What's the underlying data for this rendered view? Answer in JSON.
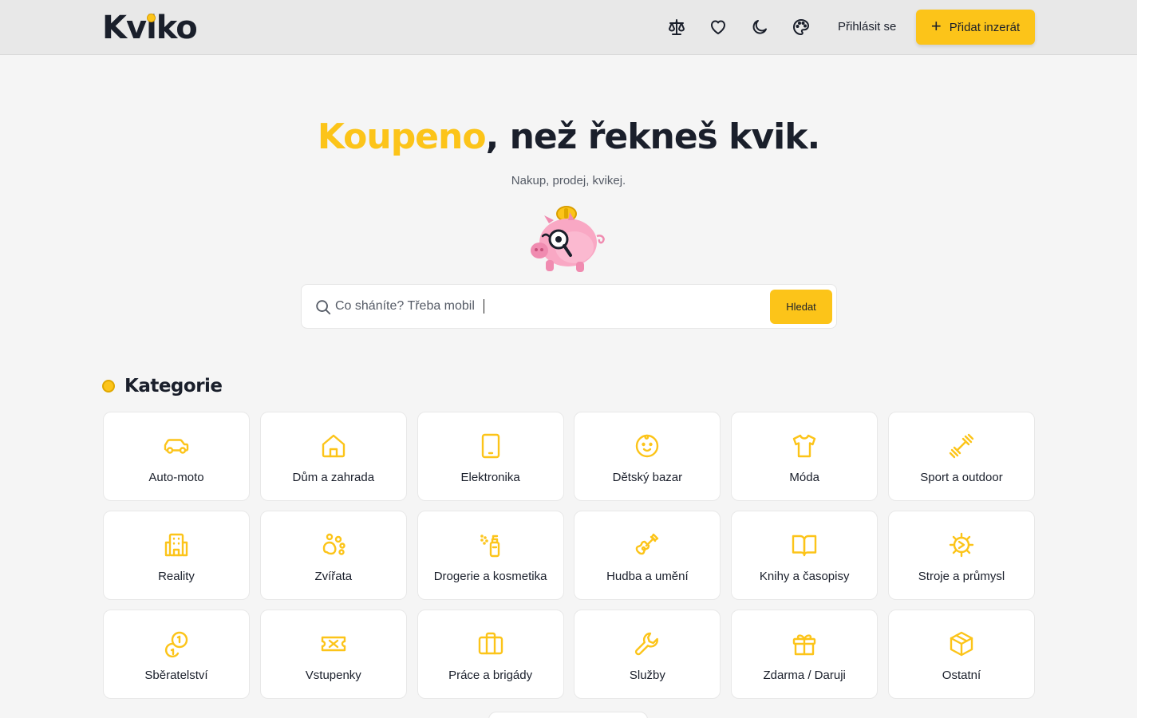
{
  "header": {
    "logo": "Kviko",
    "icons": [
      "scale-icon",
      "heart-icon",
      "moon-icon",
      "palette-icon"
    ],
    "login_label": "Přihlásit se",
    "add_label": "Přidat inzerát"
  },
  "hero": {
    "title_accent": "Koupeno",
    "title_rest": ", než řekneš kvik.",
    "subtitle": "Nakup, prodej, kvikej."
  },
  "search": {
    "placeholder": "Co sháníte? Třeba mobil",
    "button_label": "Hledat"
  },
  "categories": {
    "title": "Kategorie",
    "items": [
      {
        "label": "Auto-moto",
        "icon": "car-icon"
      },
      {
        "label": "Dům a zahrada",
        "icon": "house-icon"
      },
      {
        "label": "Elektronika",
        "icon": "tablet-icon"
      },
      {
        "label": "Dětský bazar",
        "icon": "baby-icon"
      },
      {
        "label": "Móda",
        "icon": "shirt-icon"
      },
      {
        "label": "Sport a outdoor",
        "icon": "dumbbell-icon"
      },
      {
        "label": "Reality",
        "icon": "building-icon"
      },
      {
        "label": "Zvířata",
        "icon": "paw-icon"
      },
      {
        "label": "Drogerie a kosmetika",
        "icon": "spray-bottle-icon"
      },
      {
        "label": "Hudba a umění",
        "icon": "guitar-icon"
      },
      {
        "label": "Knihy a časopisy",
        "icon": "book-icon"
      },
      {
        "label": "Stroje a průmysl",
        "icon": "gear-icon"
      },
      {
        "label": "Sběratelství",
        "icon": "coins-icon"
      },
      {
        "label": "Vstupenky",
        "icon": "ticket-icon"
      },
      {
        "label": "Práce a brigády",
        "icon": "briefcase-icon"
      },
      {
        "label": "Služby",
        "icon": "wrench-icon"
      },
      {
        "label": "Zdarma / Daruji",
        "icon": "gift-icon"
      },
      {
        "label": "Ostatní",
        "icon": "box-icon"
      }
    ]
  },
  "colors": {
    "accent": "#fcc419",
    "text": "#1a1f2b",
    "muted": "#555b66",
    "background": "#f5f5f5",
    "header_bg": "#e8e8e8"
  }
}
